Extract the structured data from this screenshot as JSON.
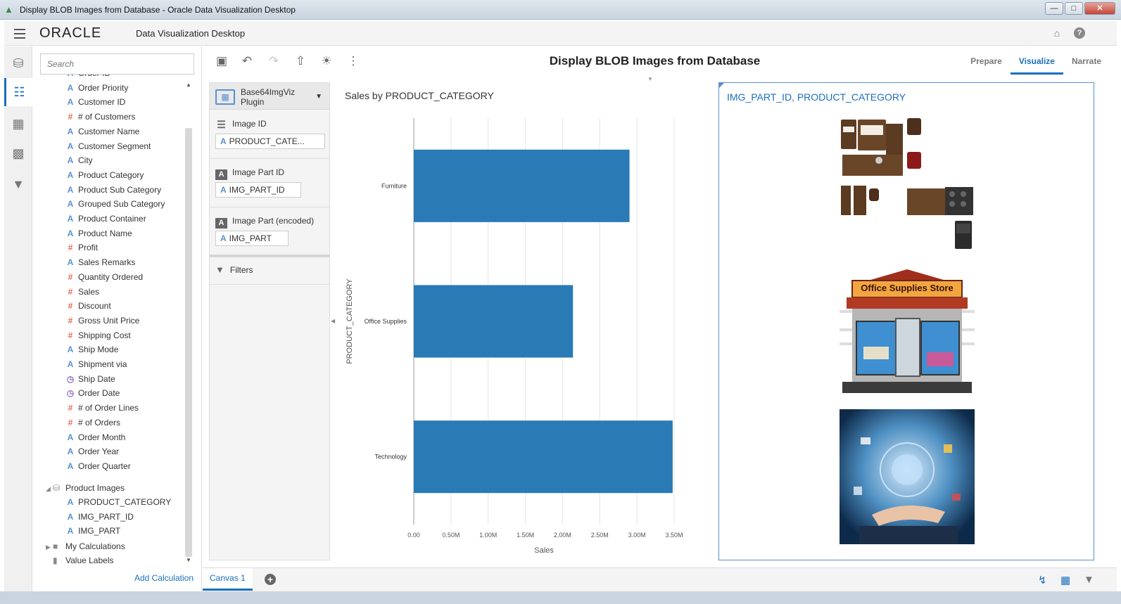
{
  "window": {
    "title": "Display BLOB Images from Database - Oracle Data Visualization Desktop"
  },
  "header": {
    "logo": "ORACLE",
    "app_name": "Data Visualization Desktop"
  },
  "data_panel": {
    "search_placeholder": "Search",
    "items": [
      {
        "label": "Order ID",
        "type": "attribute"
      },
      {
        "label": "Order Priority",
        "type": "attribute"
      },
      {
        "label": "Customer ID",
        "type": "attribute"
      },
      {
        "label": "# of Customers",
        "type": "measure"
      },
      {
        "label": "Customer Name",
        "type": "attribute"
      },
      {
        "label": "Customer Segment",
        "type": "attribute"
      },
      {
        "label": "City",
        "type": "attribute"
      },
      {
        "label": "Product Category",
        "type": "attribute"
      },
      {
        "label": "Product Sub Category",
        "type": "attribute"
      },
      {
        "label": "Grouped Sub Category",
        "type": "attribute"
      },
      {
        "label": "Product Container",
        "type": "attribute"
      },
      {
        "label": "Product Name",
        "type": "attribute"
      },
      {
        "label": "Profit",
        "type": "measure"
      },
      {
        "label": "Sales Remarks",
        "type": "attribute"
      },
      {
        "label": "Quantity Ordered",
        "type": "measure"
      },
      {
        "label": "Sales",
        "type": "measure"
      },
      {
        "label": "Discount",
        "type": "measure"
      },
      {
        "label": "Gross Unit Price",
        "type": "measure"
      },
      {
        "label": "Shipping Cost",
        "type": "measure"
      },
      {
        "label": "Ship Mode",
        "type": "attribute"
      },
      {
        "label": "Shipment via",
        "type": "attribute"
      },
      {
        "label": "Ship Date",
        "type": "time"
      },
      {
        "label": "Order Date",
        "type": "time"
      },
      {
        "label": "# of Order Lines",
        "type": "measure"
      },
      {
        "label": "# of Orders",
        "type": "measure"
      },
      {
        "label": "Order Month",
        "type": "attribute"
      },
      {
        "label": "Order Year",
        "type": "attribute"
      },
      {
        "label": "Order Quarter",
        "type": "attribute"
      }
    ],
    "product_images_folder": "Product Images",
    "product_images_items": [
      "PRODUCT_CATEGORY",
      "IMG_PART_ID",
      "IMG_PART"
    ],
    "my_calculations": "My Calculations",
    "value_labels": "Value Labels",
    "add_calculation": "Add Calculation"
  },
  "toolbar": {
    "project_title": "Display BLOB Images from Database"
  },
  "tabs": [
    "Prepare",
    "Visualize",
    "Narrate"
  ],
  "active_tab": "Visualize",
  "grammar": {
    "viz_type": "Base64ImgViz Plugin",
    "sections": [
      {
        "label": "Image ID",
        "pill": "PRODUCT_CATE..."
      },
      {
        "label": "Image Part ID",
        "pill": "IMG_PART_ID"
      },
      {
        "label": "Image Part (encoded)",
        "pill": "IMG_PART"
      }
    ],
    "filters": "Filters"
  },
  "chart_data": {
    "type": "bar",
    "orientation": "horizontal",
    "title": "Sales by PRODUCT_CATEGORY",
    "categories": [
      "Furniture",
      "Office Supplies",
      "Technology"
    ],
    "values": [
      2900000,
      2140000,
      3480000
    ],
    "xlabel": "Sales",
    "ylabel": "PRODUCT_CATEGORY",
    "xlim": [
      0,
      3500000
    ],
    "x_ticks": [
      "0.00",
      "0.50M",
      "1.00M",
      "1.50M",
      "2.00M",
      "2.50M",
      "3.00M",
      "3.50M"
    ],
    "bar_color": "#2a7ab6",
    "grid": "vertical"
  },
  "image_viz": {
    "title": "IMG_PART_ID, PRODUCT_CATEGORY",
    "store_sign": "Office Supplies Store"
  },
  "footer": {
    "canvas_tab": "Canvas 1"
  },
  "colors": {
    "accent": "#1a6fbf",
    "bar": "#2a7ab6"
  }
}
